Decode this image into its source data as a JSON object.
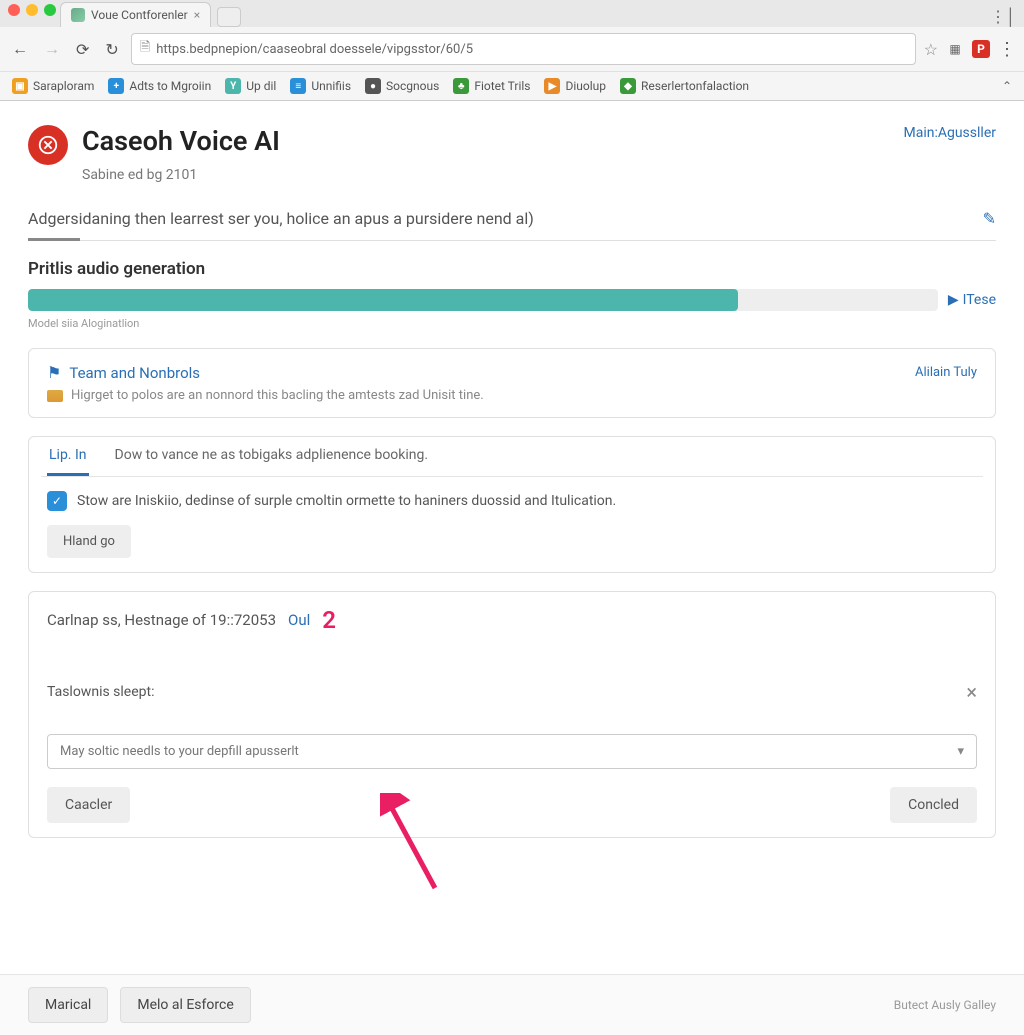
{
  "browser": {
    "tab_title": "Voue Contforenler",
    "url": "https.bedpnepion/caaseobral doessele/vipgsstor/60/5",
    "bookmarks": [
      {
        "label": "Saraploram",
        "color": "#f0a020"
      },
      {
        "label": "Adts to Mgroiin",
        "color": "#2a8fd9"
      },
      {
        "label": "Up dil",
        "color": "#4db6ac"
      },
      {
        "label": "Unnifiis",
        "color": "#2a8fd9"
      },
      {
        "label": "Socgnous",
        "color": "#555"
      },
      {
        "label": "Fiotet Trils",
        "color": "#3a9a3a"
      },
      {
        "label": "Diuolup",
        "color": "#e88a2a"
      },
      {
        "label": "Reserlertonfalaction",
        "color": "#3a9a3a"
      }
    ]
  },
  "header": {
    "title": "Caseoh Voice AI",
    "subtitle": "Sabine ed bg 2101",
    "right_link": "Main:Agussller"
  },
  "page_subtitle": "Adgersidaning then learrest ser you, holice an apus a pursidere nend al)",
  "section1": {
    "title": "Pritlis audio generation",
    "progress_pct": 78,
    "play_label": "ITese",
    "caption": "Model siia Aloginatlion"
  },
  "card_team": {
    "title": "Team and Nonbrols",
    "subtitle": "Higrget to polos are an nonnord this bacling the amtests zad Unisit tine.",
    "aside": "Alilain Tuly"
  },
  "card_tabs": {
    "tabs": [
      {
        "label": "Lip. In",
        "active": true
      },
      {
        "label": "Dow to vance ne as tobigaks adplienence booking.",
        "active": false
      }
    ],
    "check_text": "Stow are Iniskiio, dedinse of surple cmoltin ormette to haniners duossid and Itulication.",
    "button": "Hland go"
  },
  "card_form": {
    "header_text": "Carlnap ss, Hestnage of 19::72053",
    "out_label": "Oul",
    "badge": "2",
    "label": "Taslownis sleept:",
    "select_placeholder": "May soltic needls to your depfill apusserlt",
    "btn_left": "Caacler",
    "btn_right": "Concled"
  },
  "footer": {
    "btn1": "Marical",
    "btn2": "Melo al Esforce",
    "right_text": "Butect Ausly Galley"
  }
}
